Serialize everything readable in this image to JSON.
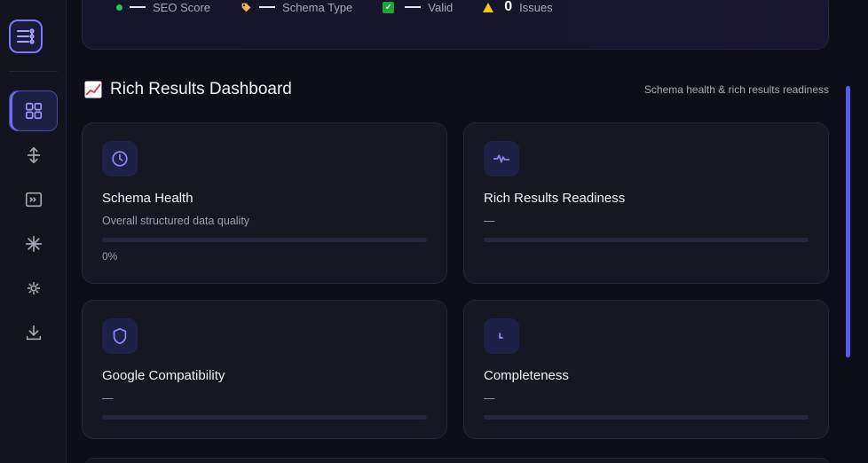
{
  "stats": {
    "seo_label": "SEO Score",
    "schema_label": "Schema Type",
    "valid_label": "Valid",
    "issues_count": "0",
    "issues_label": "Issues"
  },
  "section": {
    "title": "Rich Results Dashboard",
    "subtitle": "Schema health & rich results readiness"
  },
  "cards": [
    {
      "title": "Schema Health",
      "desc": "Overall structured data quality",
      "value": "0%",
      "progress": 0
    },
    {
      "title": "Rich Results Readiness",
      "desc": "—",
      "progress": 0
    },
    {
      "title": "Google Compatibility",
      "desc": "—",
      "progress": 0
    },
    {
      "title": "Completeness",
      "desc": "—",
      "progress": 0
    }
  ],
  "icons": {
    "nav": [
      "dashboard-icon",
      "resize-vertical-icon",
      "terminal-icon",
      "sparkle-icon",
      "settings-icon",
      "download-icon"
    ],
    "cards": [
      "clock-icon",
      "activity-icon",
      "shield-icon",
      "pie-icon"
    ]
  },
  "colors": {
    "accent": "#6f6cf0",
    "valid": "#22a33a",
    "warning": "#f5c518",
    "seo_dot": "#22c55e"
  }
}
